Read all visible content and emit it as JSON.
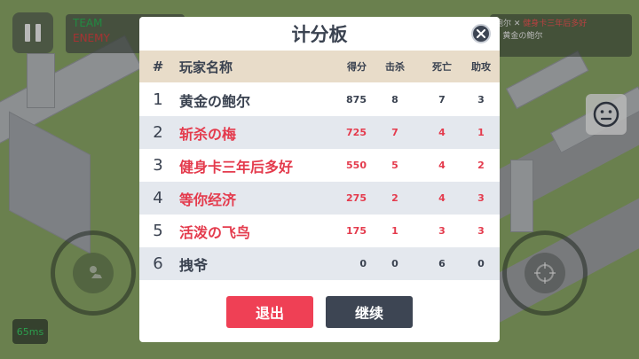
{
  "hud": {
    "team_label": "TEAM",
    "enemy_label": "ENEMY",
    "ping": "65ms",
    "killfeed": [
      {
        "killer": "鲍尔",
        "victim": "健身卡三年后多好"
      },
      {
        "killer": "",
        "victim": "黄金の鲍尔"
      }
    ]
  },
  "scoreboard": {
    "title": "计分板",
    "headers": {
      "rank": "#",
      "name": "玩家名称",
      "score": "得分",
      "kills": "击杀",
      "deaths": "死亡",
      "assists": "助攻"
    },
    "rows": [
      {
        "rank": "1",
        "name": "黄金の鲍尔",
        "score": "875",
        "kills": "8",
        "deaths": "7",
        "assists": "3",
        "team": "self"
      },
      {
        "rank": "2",
        "name": "斩杀の梅",
        "score": "725",
        "kills": "7",
        "deaths": "4",
        "assists": "1",
        "team": "enemy"
      },
      {
        "rank": "3",
        "name": "健身卡三年后多好",
        "score": "550",
        "kills": "5",
        "deaths": "4",
        "assists": "2",
        "team": "enemy"
      },
      {
        "rank": "4",
        "name": "等你经济",
        "score": "275",
        "kills": "2",
        "deaths": "4",
        "assists": "3",
        "team": "enemy"
      },
      {
        "rank": "5",
        "name": "活泼の飞鸟",
        "score": "175",
        "kills": "1",
        "deaths": "3",
        "assists": "3",
        "team": "enemy"
      },
      {
        "rank": "6",
        "name": "拽爷",
        "score": "0",
        "kills": "0",
        "deaths": "6",
        "assists": "0",
        "team": "self"
      }
    ],
    "exit_label": "退出",
    "continue_label": "继续"
  },
  "colors": {
    "self": "#3a4250",
    "enemy": "#e43b4d",
    "header_bg": "#e8dcc9",
    "exit": "#ef4055",
    "continue": "#3d4553"
  },
  "icons": [
    "pause-icon",
    "close-icon",
    "emoji-icon",
    "movement-joystick-icon",
    "aim-crosshair-icon"
  ]
}
